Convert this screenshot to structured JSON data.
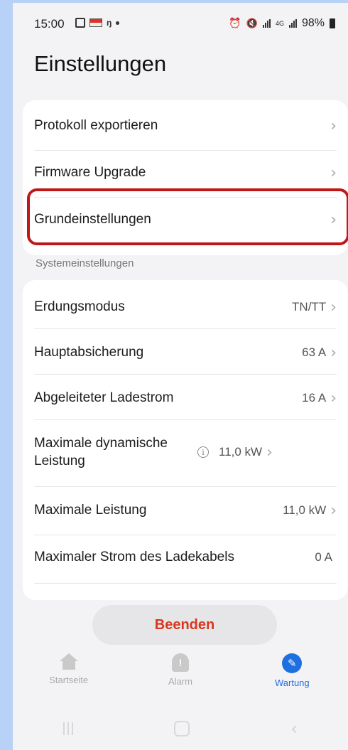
{
  "status_bar": {
    "time": "15:00",
    "battery": "98%",
    "network": "4G"
  },
  "title": "Einstellungen",
  "menu": [
    {
      "label": "Protokoll exportieren"
    },
    {
      "label": "Firmware Upgrade"
    },
    {
      "label": "Grundeinstellungen"
    }
  ],
  "section_title": "Systemeinstellungen",
  "settings": [
    {
      "label": "Erdungsmodus",
      "value": "TN/TT"
    },
    {
      "label": "Hauptabsicherung",
      "value": "63 A"
    },
    {
      "label": "Abgeleiteter Ladestrom",
      "value": "16 A"
    },
    {
      "label": "Maximale dynamische Leistung",
      "value": "11,0 kW"
    },
    {
      "label": "Maximale Leistung",
      "value": "11,0 kW"
    },
    {
      "label": "Maximaler Strom des Ladekabels",
      "value": "0 A"
    }
  ],
  "exit_button": "Beenden",
  "nav": [
    {
      "label": "Startseite",
      "icon": "home-icon"
    },
    {
      "label": "Alarm",
      "icon": "alarm-icon"
    },
    {
      "label": "Wartung",
      "icon": "wrench-icon"
    }
  ],
  "colors": {
    "accent": "#1e6fe0",
    "exit_text": "#d9381e",
    "highlight": "#c01818"
  }
}
